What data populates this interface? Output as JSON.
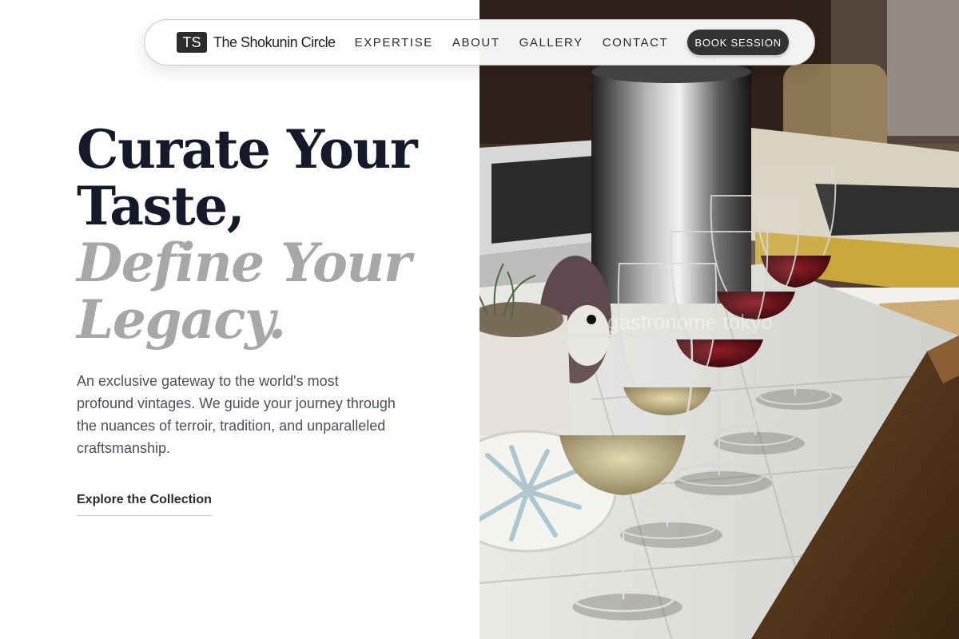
{
  "nav": {
    "logo_mark": "TS",
    "brand": "The Shokunin Circle",
    "links": [
      "EXPERTISE",
      "ABOUT",
      "GALLERY",
      "CONTACT"
    ],
    "cta": "BOOK SESSION"
  },
  "hero": {
    "line1": "Curate Your",
    "line2": "Taste,",
    "line3": "Define Your",
    "line4": "Legacy.",
    "body": "An exclusive gateway to the world's most profound vintages. We guide your journey through the nuances of terroir, tradition, and unparalleled craftsmanship.",
    "link": "Explore the Collection"
  },
  "photo": {
    "watermark": "gastronome tokyo"
  },
  "colors": {
    "headline": "#141a2a",
    "headline_alt": "#a7a7a7",
    "cta_bg": "#333333",
    "body_text": "#4a5060"
  }
}
